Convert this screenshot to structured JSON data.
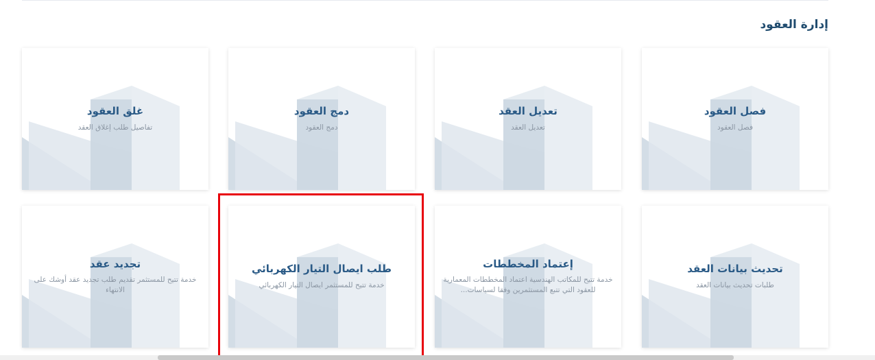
{
  "section": {
    "title": "إدارة العقود"
  },
  "cards": [
    {
      "title": "فصل العقود",
      "desc": "فصل العقود"
    },
    {
      "title": "تعديل العقد",
      "desc": "تعديل العقد"
    },
    {
      "title": "دمج العقود",
      "desc": "دمج العقود"
    },
    {
      "title": "غلق العقود",
      "desc": "تفاصيل طلب إغلاق العقد"
    },
    {
      "title": "تحديث بيانات العقد",
      "desc": "طلبات تحديث بيانات العقد"
    },
    {
      "title": "إعتماد المخططات",
      "desc": "خدمة تتيح للمكاتب الهندسية اعتماد المخططات المعمارية للعقود التي تتبع المستثمرين وفقا لسياسات..."
    },
    {
      "title": "طلب ايصال التيار الكهربائي",
      "desc": "خدمة تتيح للمستثمر ايصال التيار الكهربائي"
    },
    {
      "title": "تجديد عقد",
      "desc": "خدمة تتيح للمستثمر تقديم طلب تجديد عقد أوشك على الانتهاء"
    }
  ],
  "colors": {
    "title": "#2a5a86",
    "section_title": "#1f4b6e",
    "description": "#8b96a3",
    "highlight": "#e8000b"
  }
}
